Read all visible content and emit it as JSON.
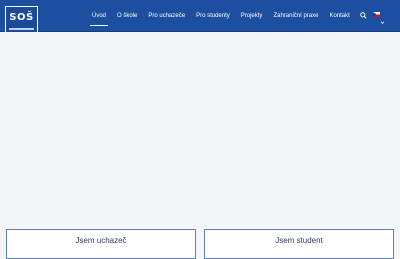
{
  "header": {
    "logo_text": "SOŠ",
    "nav": [
      {
        "label": "Úvod",
        "active": true
      },
      {
        "label": "O škole",
        "active": false
      },
      {
        "label": "Pro uchazeče",
        "active": false
      },
      {
        "label": "Pro studenty",
        "active": false
      },
      {
        "label": "Projekty",
        "active": false
      },
      {
        "label": "Zahraniční praxe",
        "active": false
      },
      {
        "label": "Kontakt",
        "active": false
      }
    ],
    "search_icon": "search-icon",
    "language_icon": "flag-cz-icon"
  },
  "cards": [
    {
      "title": "Jsem uchazeč"
    },
    {
      "title": "Jsem student"
    }
  ],
  "colors": {
    "header_bg": "#1c4fa0",
    "card_border": "#5c7fc0",
    "page_bg": "#f4f5f7"
  }
}
